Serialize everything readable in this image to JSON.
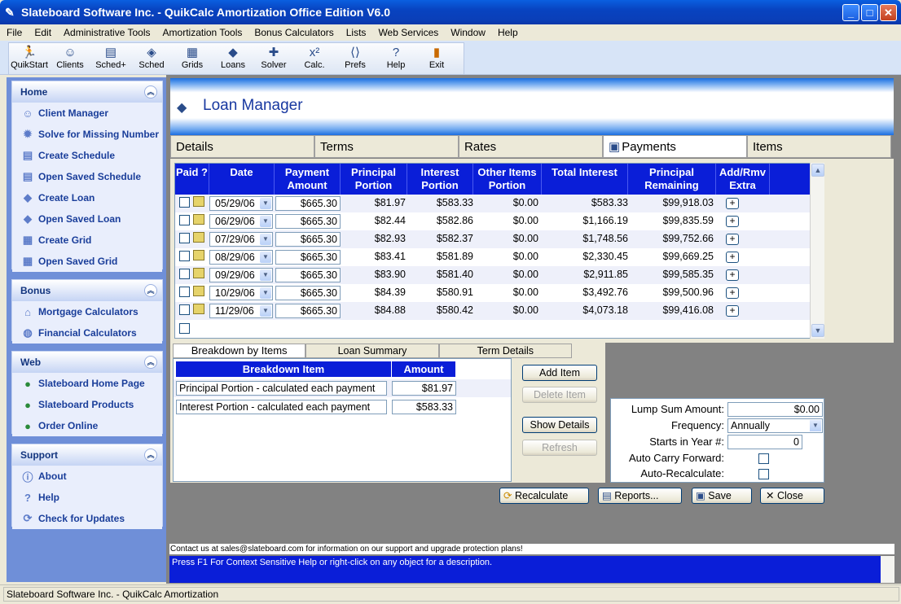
{
  "window": {
    "title": "Slateboard Software Inc. - QuikCalc Amortization Office Edition V6.0"
  },
  "menu": [
    "File",
    "Edit",
    "Administrative Tools",
    "Amortization Tools",
    "Bonus Calculators",
    "Lists",
    "Web Services",
    "Window",
    "Help"
  ],
  "toolbar": [
    "QuikStart",
    "Clients",
    "Sched+",
    "Sched",
    "Grids",
    "Loans",
    "Solver",
    "Calc.",
    "Prefs",
    "Help",
    "Exit"
  ],
  "sidebar": {
    "home": {
      "title": "Home",
      "items": [
        "Client Manager",
        "Solve for Missing Number",
        "Create Schedule",
        "Open Saved Schedule",
        "Create Loan",
        "Open Saved Loan",
        "Create Grid",
        "Open Saved Grid"
      ]
    },
    "bonus": {
      "title": "Bonus",
      "items": [
        "Mortgage Calculators",
        "Financial Calculators"
      ]
    },
    "web": {
      "title": "Web",
      "items": [
        "Slateboard Home Page",
        "Slateboard Products",
        "Order Online"
      ]
    },
    "support": {
      "title": "Support",
      "items": [
        "About",
        "Help",
        "Check for Updates"
      ]
    }
  },
  "main": {
    "title": "Loan Manager",
    "tabs": [
      "Details",
      "Terms",
      "Rates",
      "Payments",
      "Items"
    ],
    "columns": [
      "Paid ?",
      "Date",
      "Payment Amount",
      "Principal Portion",
      "Interest Portion",
      "Other Items Portion",
      "Total Interest",
      "Principal Remaining",
      "Add/Rmv Extra"
    ],
    "rows": [
      {
        "date": "05/29/06",
        "payment": "$665.30",
        "principal": "$81.97",
        "interest": "$583.33",
        "other": "$0.00",
        "total_interest": "$583.33",
        "remaining": "$99,918.03"
      },
      {
        "date": "06/29/06",
        "payment": "$665.30",
        "principal": "$82.44",
        "interest": "$582.86",
        "other": "$0.00",
        "total_interest": "$1,166.19",
        "remaining": "$99,835.59"
      },
      {
        "date": "07/29/06",
        "payment": "$665.30",
        "principal": "$82.93",
        "interest": "$582.37",
        "other": "$0.00",
        "total_interest": "$1,748.56",
        "remaining": "$99,752.66"
      },
      {
        "date": "08/29/06",
        "payment": "$665.30",
        "principal": "$83.41",
        "interest": "$581.89",
        "other": "$0.00",
        "total_interest": "$2,330.45",
        "remaining": "$99,669.25"
      },
      {
        "date": "09/29/06",
        "payment": "$665.30",
        "principal": "$83.90",
        "interest": "$581.40",
        "other": "$0.00",
        "total_interest": "$2,911.85",
        "remaining": "$99,585.35"
      },
      {
        "date": "10/29/06",
        "payment": "$665.30",
        "principal": "$84.39",
        "interest": "$580.91",
        "other": "$0.00",
        "total_interest": "$3,492.76",
        "remaining": "$99,500.96"
      },
      {
        "date": "11/29/06",
        "payment": "$665.30",
        "principal": "$84.88",
        "interest": "$580.42",
        "other": "$0.00",
        "total_interest": "$4,073.18",
        "remaining": "$99,416.08"
      }
    ],
    "subtabs": [
      "Breakdown by Items",
      "Loan Summary",
      "Term Details"
    ],
    "breakdown": {
      "columns": [
        "Breakdown Item",
        "Amount"
      ],
      "rows": [
        {
          "item": "Principal Portion - calculated each payment",
          "amount": "$81.97"
        },
        {
          "item": "Interest Portion - calculated each payment",
          "amount": "$583.33"
        }
      ]
    },
    "item_buttons": {
      "add": "Add Item",
      "delete": "Delete Item",
      "show": "Show Details",
      "refresh": "Refresh"
    },
    "lump": {
      "amount_label": "Lump Sum Amount:",
      "amount": "$0.00",
      "frequency_label": "Frequency:",
      "frequency": "Annually",
      "starts_label": "Starts in Year #:",
      "starts": "0",
      "carry_label": "Auto Carry Forward:",
      "recalc_label": "Auto-Recalculate:"
    },
    "actions": {
      "recalculate": "Recalculate",
      "reports": "Reports...",
      "save": "Save",
      "close": "Close"
    }
  },
  "info": "Contact us at sales@slateboard.com for information on our support and upgrade protection plans!",
  "help": "Press F1 For Context Sensitive Help or right-click on any object for a description.",
  "status": "Slateboard Software Inc. - QuikCalc Amortization"
}
